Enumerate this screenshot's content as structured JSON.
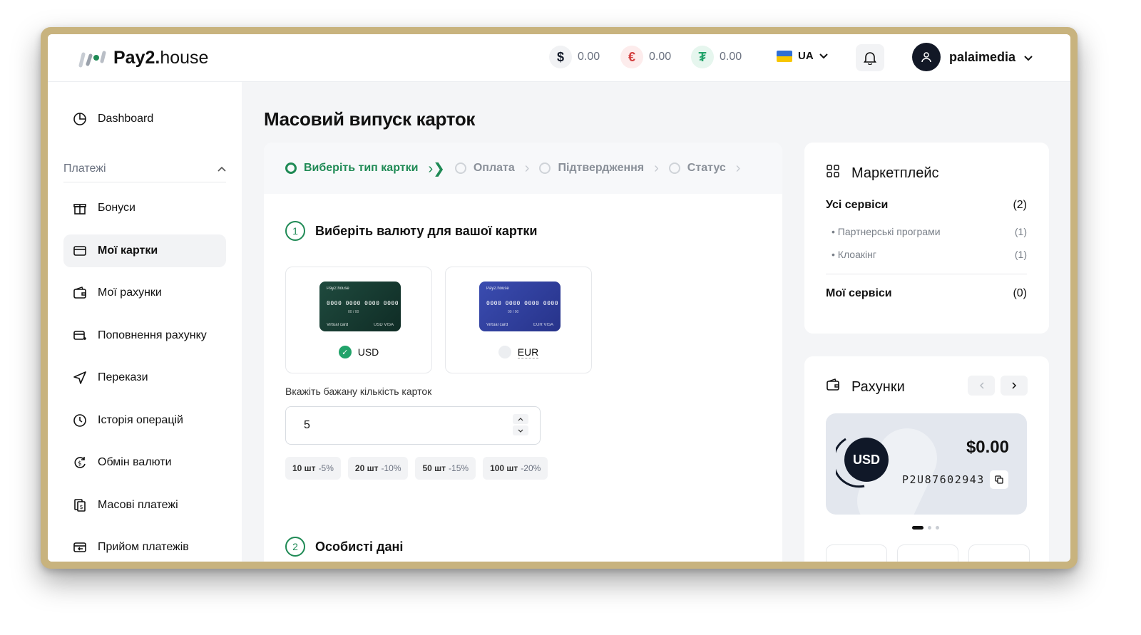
{
  "header": {
    "logo": {
      "bold": "Pay2",
      "dot": ".",
      "light": "house"
    },
    "balances": [
      {
        "symbol": "$",
        "value": "0.00",
        "color": "#111827",
        "bg": "#f1f2f4"
      },
      {
        "symbol": "€",
        "value": "0.00",
        "color": "#d23f3f",
        "bg": "#fdecec"
      },
      {
        "symbol": "₮",
        "value": "0.00",
        "color": "#22a36a",
        "bg": "#e6f6ee"
      }
    ],
    "language": "UA",
    "username": "palaimedia"
  },
  "sidebar": {
    "dashboard": "Dashboard",
    "section": "Платежі",
    "items": [
      {
        "label": "Бонуси",
        "icon": "gift-icon"
      },
      {
        "label": "Мої картки",
        "icon": "card-icon",
        "active": true
      },
      {
        "label": "Мої рахунки",
        "icon": "wallet-icon"
      },
      {
        "label": "Поповнення рахунку",
        "icon": "card-plus-icon"
      },
      {
        "label": "Перекази",
        "icon": "send-icon"
      },
      {
        "label": "Історія операцій",
        "icon": "clock-icon"
      },
      {
        "label": "Обмін валюти",
        "icon": "exchange-icon"
      },
      {
        "label": "Масові платежі",
        "icon": "mass-payments-icon"
      },
      {
        "label": "Прийом платежів",
        "icon": "receive-payments-icon"
      }
    ]
  },
  "main": {
    "title": "Масовий випуск карток",
    "steps": [
      "Виберіть тип картки",
      "Оплата",
      "Підтвердження",
      "Статус"
    ],
    "section1": {
      "num": "1",
      "title": "Виберіть валюту для вашої картки"
    },
    "currencies": [
      {
        "code": "USD",
        "selected": true,
        "card_bg": "#163a31",
        "card_number": "0000 0000 0000 0000",
        "card_brand": "Pay2.house",
        "card_expiry": "00 / 00",
        "card_type": "Virtual card",
        "card_network": "USD VISA"
      },
      {
        "code": "EUR",
        "selected": false,
        "card_bg": "#2f3f9e",
        "card_number": "0000 0000 0000 0000",
        "card_brand": "Pay2.house",
        "card_expiry": "00 / 00",
        "card_type": "Virtual card",
        "card_network": "EUR VISA"
      }
    ],
    "quantity_label": "Вкажіть бажану кількість карток",
    "quantity_value": "5",
    "presets": [
      {
        "qty": "10 шт",
        "disc": "-5%"
      },
      {
        "qty": "20 шт",
        "disc": "-10%"
      },
      {
        "qty": "50 шт",
        "disc": "-15%"
      },
      {
        "qty": "100 шт",
        "disc": "-20%"
      }
    ],
    "section2": {
      "num": "2",
      "title": "Особисті дані"
    }
  },
  "marketplace": {
    "title": "Маркетплейс",
    "all_services": "Усі сервіси",
    "all_count": "(2)",
    "sub": [
      {
        "label": "Партнерські програми",
        "count": "(1)"
      },
      {
        "label": "Клоакінг",
        "count": "(1)"
      }
    ],
    "my_services": "Мої сервіси",
    "my_count": "(0)"
  },
  "accounts": {
    "title": "Рахунки",
    "currency": "USD",
    "amount": "$0.00",
    "account_id": "P2U87602943",
    "slide_count": 3,
    "active_slide": 0
  },
  "colors": {
    "accent": "#1f8a55",
    "dark": "#101828"
  }
}
